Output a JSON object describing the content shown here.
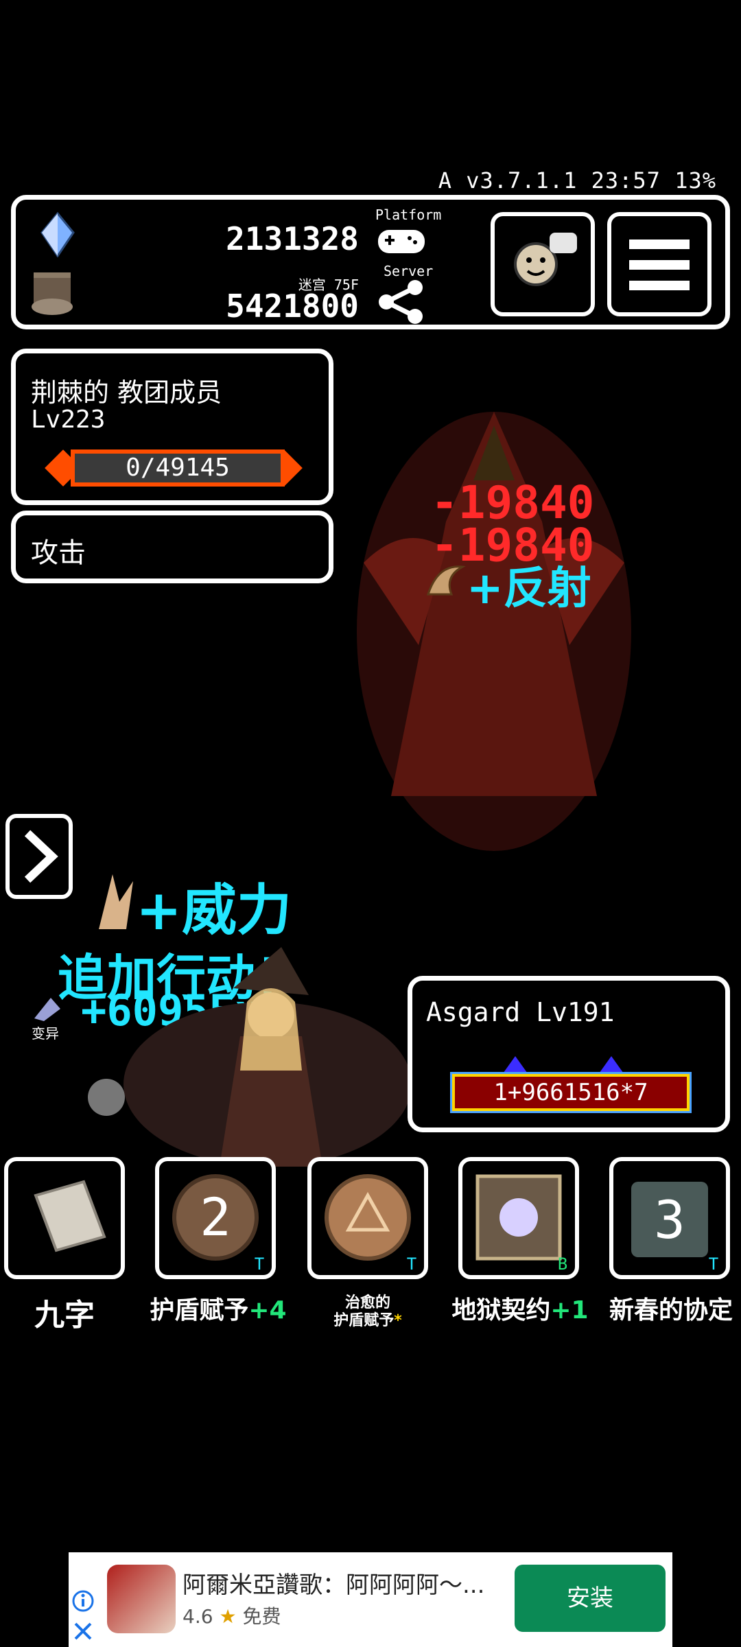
{
  "status": {
    "text": "A v3.7.1.1 23:57 13%"
  },
  "hud": {
    "gems": "2131328",
    "floor_label": "迷宫 75F",
    "gold": "5421800",
    "platform_label": "Platform",
    "server_label": "Server"
  },
  "enemy": {
    "name": "荆棘的 教团成员",
    "level": "Lv223",
    "hp": "0/49145"
  },
  "action": {
    "label": "攻击"
  },
  "combat": {
    "damage1": "-19840",
    "damage2": "-19840",
    "reflect": "+反射",
    "power": "+威力",
    "extra_action": "追加行动！",
    "exp": "+6095Exp",
    "mutation": "变异"
  },
  "player": {
    "name": "Asgard Lv191",
    "hp": "1+9661516*7"
  },
  "skills": [
    {
      "label": "九字",
      "bonus": "",
      "corner": ""
    },
    {
      "label": "护盾赋予",
      "bonus": "+4",
      "corner": "T",
      "count": "2"
    },
    {
      "label_line1": "治愈的",
      "label_line2": "护盾赋予",
      "bonus": "*",
      "corner": "T"
    },
    {
      "label": "地狱契约",
      "bonus": "+1",
      "corner": "B"
    },
    {
      "label": "新春的协定",
      "bonus": "",
      "corner": "T",
      "count": "3"
    }
  ],
  "ad": {
    "title": "阿爾米亞讚歌：阿阿阿阿～...",
    "rating": "4.6",
    "price": "免费",
    "install": "安装"
  },
  "colors": {
    "damage": "#ff2a2a",
    "cyan": "#22e6ff",
    "hpbar": "#ff4d00",
    "install": "#0b8a55"
  }
}
